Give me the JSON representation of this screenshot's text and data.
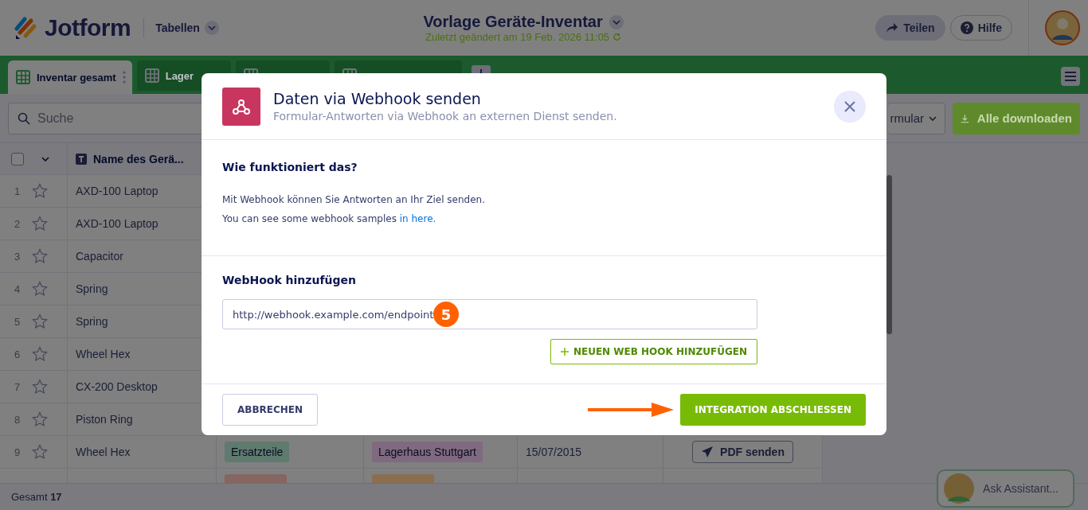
{
  "header": {
    "brand": "Jotform",
    "section": "Tabellen",
    "title": "Vorlage Geräte-Inventar",
    "last_saved": "Zuletzt geändert am 19 Feb. 2026 11:05",
    "share": "Teilen",
    "help": "Hilfe"
  },
  "tabs": [
    {
      "label": "Inventar gesamt",
      "selected": true
    },
    {
      "label": "Lager",
      "selected": false
    },
    {
      "selected": false
    },
    {
      "selected": false
    }
  ],
  "toolbar": {
    "search_placeholder": "Suche",
    "form_button": "rmular",
    "download_button": "Alle downloaden"
  },
  "table": {
    "select_all_checked": false,
    "name_column": "Name des Gerä...",
    "rows": [
      {
        "number": "1",
        "starred": false,
        "name": "AXD-100 Laptop"
      },
      {
        "number": "2",
        "starred": false,
        "name": "AXD-100 Laptop"
      },
      {
        "number": "3",
        "starred": false,
        "name": "Capacitor"
      },
      {
        "number": "4",
        "starred": false,
        "name": "Spring"
      },
      {
        "number": "5",
        "starred": false,
        "name": "Spring"
      },
      {
        "number": "6",
        "starred": false,
        "name": "Wheel Hex"
      },
      {
        "number": "7",
        "starred": false,
        "name": "CX-200 Desktop"
      },
      {
        "number": "8",
        "starred": false,
        "name": "Piston Ring"
      },
      {
        "number": "9",
        "starred": false,
        "name": "Wheel Hex",
        "category": {
          "label": "Ersatzteile",
          "color": "#5f7a6e"
        },
        "location": {
          "label": "Lagerhaus Stuttgart",
          "color": "#806a80"
        },
        "date": "15/07/2015",
        "action": "PDF senden"
      },
      {
        "category": {
          "color": "#866660"
        },
        "location": {
          "color": "#8a6e50"
        }
      }
    ],
    "footer": "Gesamt **17**"
  },
  "modal": {
    "title": "Daten via Webhook senden",
    "subtitle": "Formular-Antworten via Webhook an externen Dienst senden.",
    "how_heading": "Wie funktioniert das?",
    "how_text": "Mit Webhook können Sie Antworten an Ihr Ziel senden.",
    "samples_text": "You can see some webhook samples",
    "samples_link": "in here.",
    "add_heading": "WebHook hinzufügen",
    "webhook_url": "http://webhook.example.com/endpoint",
    "step_badge": "5",
    "add_button": "NEUEN WEB HOOK HINZUFÜGEN",
    "cancel_button": "ABBRECHEN",
    "finish_button": "INTEGRATION ABSCHLIESSEN"
  },
  "assistant": {
    "label": "Ask Assistant..."
  }
}
